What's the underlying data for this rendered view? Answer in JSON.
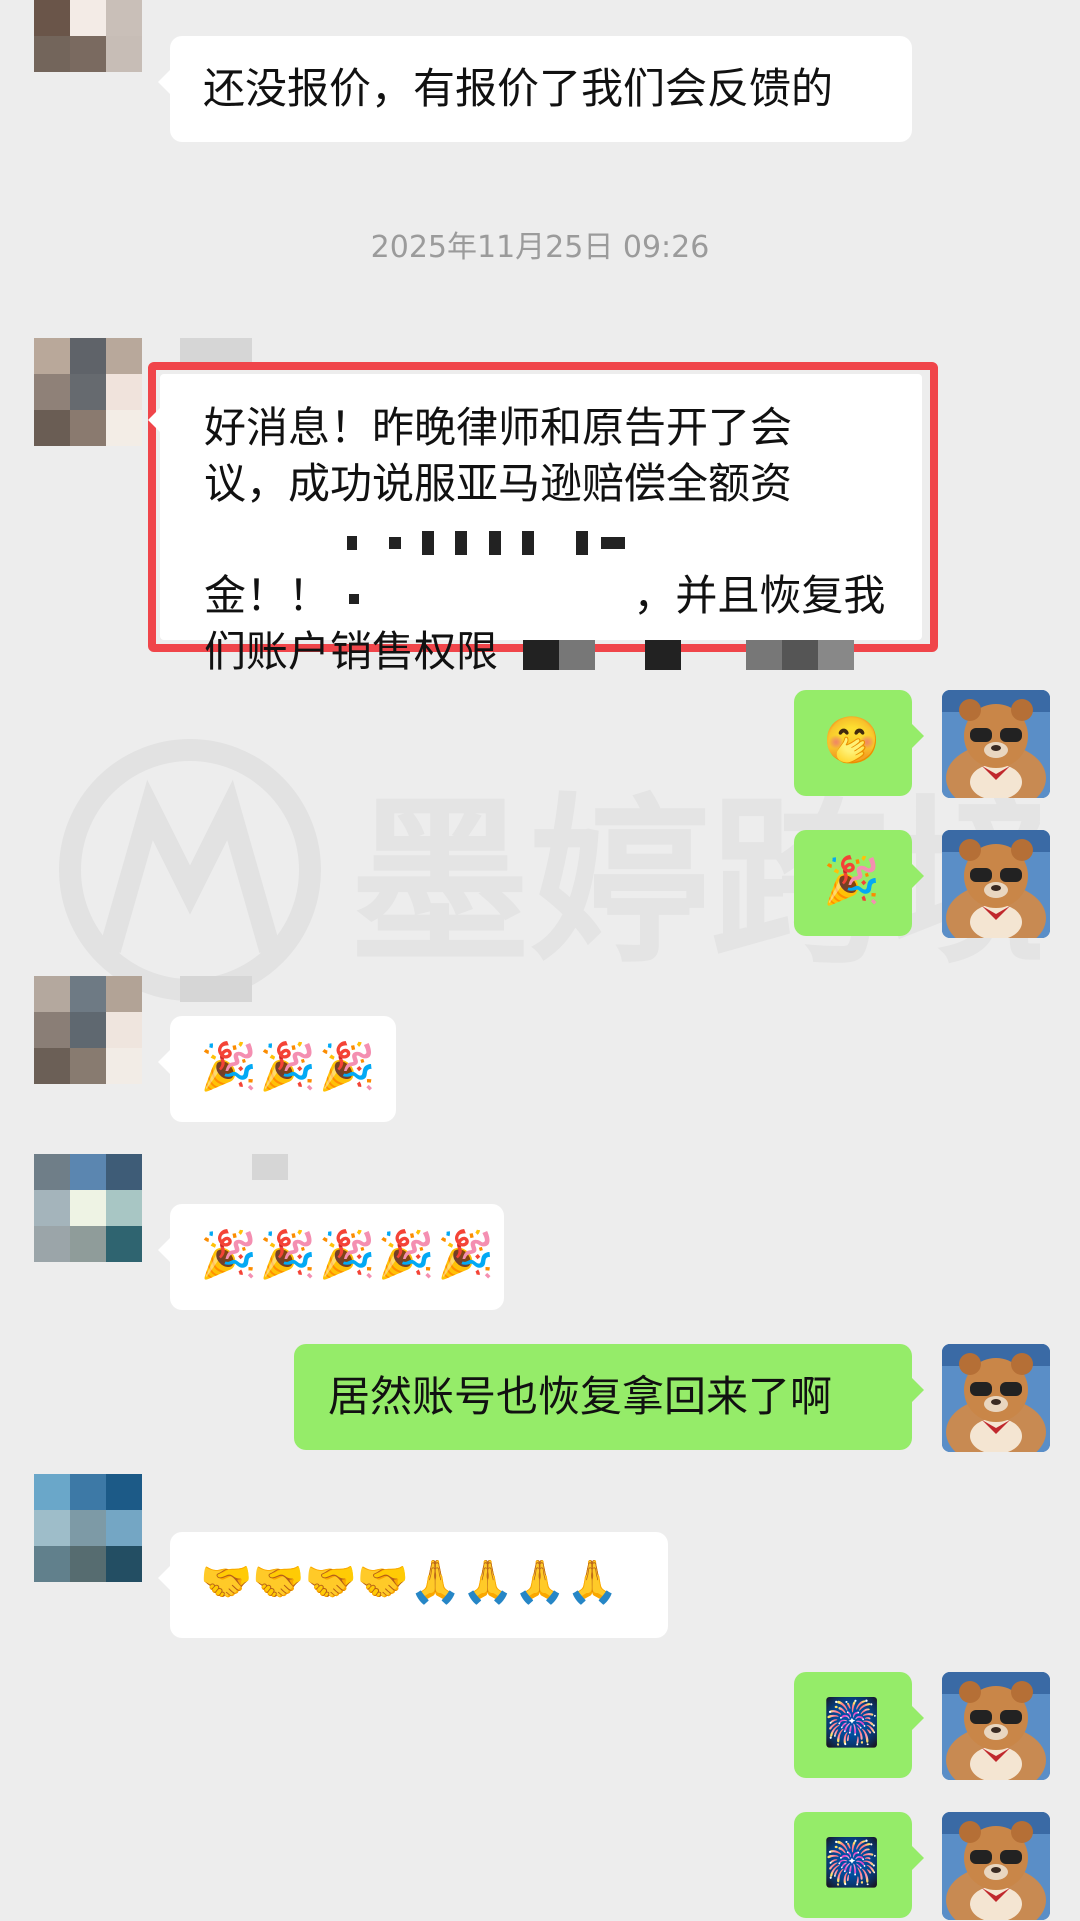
{
  "timestamp": "2025年11月25日 09:26",
  "messages": [
    {
      "text": "还没报价，有报价了我们会反馈的"
    },
    {
      "text_lines": [
        "好消息！昨晚律师和原告开了会",
        "议，成功说服亚马逊赔偿全额资",
        "金！！",
        "，并且恢复我",
        "们账户销售权限"
      ]
    },
    {
      "emoji": "🤭",
      "emoji_name": "hand-over-mouth"
    },
    {
      "emoji": "🎉",
      "emoji_name": "party-popper"
    },
    {
      "emoji": "🎉🎉🎉",
      "emoji_name": "party-popper-x3"
    },
    {
      "emoji": "🎉🎉🎉🎉🎉",
      "emoji_name": "party-popper-x5"
    },
    {
      "text": "居然账号也恢复拿回来了啊"
    },
    {
      "emoji": "🤝🤝🤝🤝🙏🙏🙏🙏",
      "emoji_name": "handshake-and-pray"
    },
    {
      "emoji": "🎆",
      "emoji_name": "fireworks"
    },
    {
      "emoji": "🎆",
      "emoji_name": "fireworks"
    }
  ],
  "watermark": "墨婷跨境",
  "colors": {
    "background": "#ededed",
    "incoming_bubble": "#ffffff",
    "outgoing_bubble": "#95ec69",
    "highlight_border": "#f0454a"
  }
}
